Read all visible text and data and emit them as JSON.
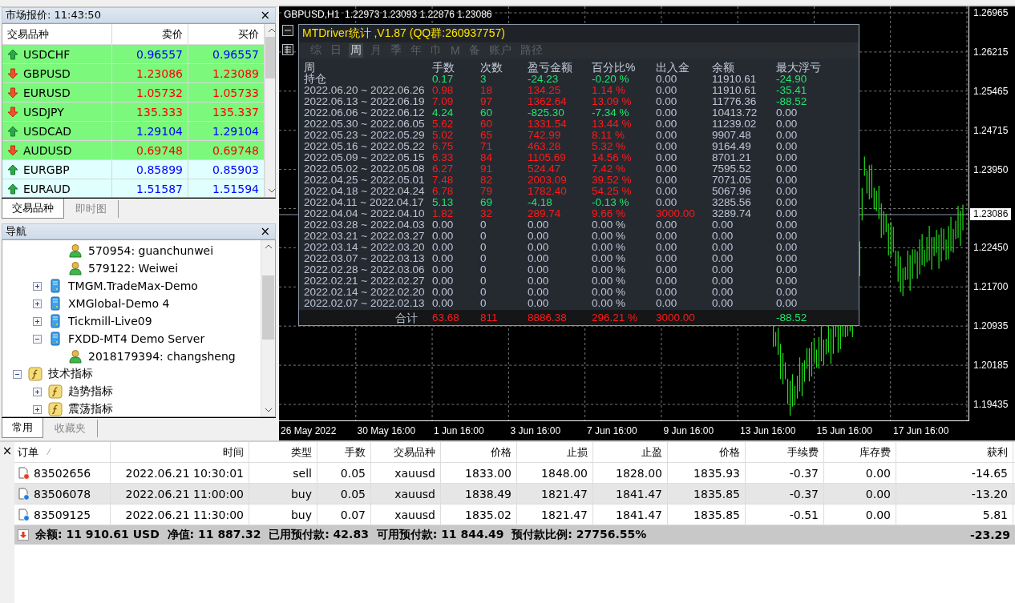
{
  "market_watch": {
    "title": "市场报价: 11:43:50",
    "close": "×",
    "columns": [
      "交易品种",
      "卖价",
      "买价"
    ],
    "rows": [
      {
        "symbol": "USDCHF",
        "bid": "0.96557",
        "ask": "0.96557",
        "kind": "up",
        "highlighted": true
      },
      {
        "symbol": "GBPUSD",
        "bid": "1.23086",
        "ask": "1.23089",
        "kind": "down",
        "highlighted": true
      },
      {
        "symbol": "EURUSD",
        "bid": "1.05732",
        "ask": "1.05733",
        "kind": "down",
        "highlighted": true
      },
      {
        "symbol": "USDJPY",
        "bid": "135.333",
        "ask": "135.337",
        "kind": "down",
        "highlighted": true
      },
      {
        "symbol": "USDCAD",
        "bid": "1.29104",
        "ask": "1.29104",
        "kind": "up",
        "highlighted": true
      },
      {
        "symbol": "AUDUSD",
        "bid": "0.69748",
        "ask": "0.69748",
        "kind": "down",
        "highlighted": true
      },
      {
        "symbol": "EURGBP",
        "bid": "0.85899",
        "ask": "0.85903",
        "kind": "up",
        "highlighted": false
      },
      {
        "symbol": "EURAUD",
        "bid": "1.51587",
        "ask": "1.51594",
        "kind": "up",
        "highlighted": false
      }
    ],
    "tabs": [
      {
        "label": "交易品种",
        "selected": true
      },
      {
        "label": "即时图",
        "selected": false
      }
    ]
  },
  "navigator": {
    "title": "导航",
    "close": "×",
    "tree": [
      {
        "children": [
          {
            "children": [
              {
                "label": "570954: guanchunwei",
                "kind": "account"
              },
              {
                "label": "579122: Weiwei",
                "kind": "account"
              }
            ]
          },
          {
            "label": "TMGM.TradeMax-Demo",
            "kind": "server",
            "expanded": false
          },
          {
            "label": "XMGlobal-Demo 4",
            "kind": "server",
            "expanded": false
          },
          {
            "label": "Tickmill-Live09",
            "kind": "server",
            "expanded": false
          },
          {
            "label": "FXDD-MT4 Demo Server",
            "kind": "server",
            "expanded": true,
            "children": [
              {
                "label": "2018179394: changsheng",
                "kind": "account"
              }
            ]
          }
        ]
      },
      {
        "label": "技术指标",
        "kind": "indicator",
        "expanded": true,
        "children": [
          {
            "label": "趋势指标",
            "kind": "indicator",
            "expanded": false
          },
          {
            "label": "震荡指标",
            "kind": "indicator",
            "expanded": false
          }
        ]
      }
    ],
    "tabs": [
      {
        "label": "常用",
        "selected": true
      },
      {
        "label": "收藏夹",
        "selected": false
      }
    ]
  },
  "chart": {
    "title": "GBPUSD,H1  1.22973 1.23093 1.22876 1.23086",
    "current_price": "1.23086",
    "price_labels": [
      "1.26965",
      "1.26215",
      "1.25465",
      "1.24715",
      "1.23950",
      "1.22450",
      "1.21700",
      "1.20935",
      "1.20185",
      "1.19435"
    ],
    "time_labels": [
      "26 May 2022",
      "30 May 16:00",
      "1 Jun 16:00",
      "3 Jun 16:00",
      "7 Jun 16:00",
      "9 Jun 16:00",
      "13 Jun 16:00",
      "15 Jun 16:00",
      "17 Jun 16:00"
    ]
  },
  "stats": {
    "title": "MTDriver统计 ,V1.87 (QQ群:260937757)",
    "menu": [
      {
        "label": "综",
        "selected": false
      },
      {
        "label": "日",
        "selected": false
      },
      {
        "label": "周",
        "selected": true
      },
      {
        "label": "月",
        "selected": false
      },
      {
        "label": "季",
        "selected": false
      },
      {
        "label": "年",
        "selected": false
      },
      {
        "label": "巾",
        "selected": false
      },
      {
        "label": "M",
        "selected": false
      },
      {
        "label": "备",
        "selected": false
      },
      {
        "label": "账户",
        "selected": false
      },
      {
        "label": "路径",
        "selected": false
      }
    ],
    "columns": [
      "周",
      "手数",
      "次数",
      "盈亏金额",
      "百分比%",
      "出入金",
      "余额",
      "最大浮亏"
    ],
    "rows": [
      {
        "cells": [
          "持仓",
          "0.17",
          "3",
          "-24.23",
          "-0.20 %",
          "0.00",
          "11910.61",
          "-24.90"
        ],
        "kind": "loss",
        "deposit_flagged": false,
        "float_flagged": true
      },
      {
        "cells": [
          "2022.06.20 ~ 2022.06.26",
          "0.98",
          "18",
          "134.25",
          "1.14 %",
          "0.00",
          "11910.61",
          "-35.41"
        ],
        "kind": "profit",
        "deposit_flagged": false,
        "float_flagged": true
      },
      {
        "cells": [
          "2022.06.13 ~ 2022.06.19",
          "7.09",
          "97",
          "1362.64",
          "13.09 %",
          "0.00",
          "11776.36",
          "-88.52"
        ],
        "kind": "profit",
        "deposit_flagged": false,
        "float_flagged": true
      },
      {
        "cells": [
          "2022.06.06 ~ 2022.06.12",
          "4.24",
          "60",
          "-825.30",
          "-7.34 %",
          "0.00",
          "10413.72",
          "0.00"
        ],
        "kind": "loss",
        "deposit_flagged": false,
        "float_flagged": false
      },
      {
        "cells": [
          "2022.05.30 ~ 2022.06.05",
          "5.62",
          "60",
          "1331.54",
          "13.44 %",
          "0.00",
          "11239.02",
          "0.00"
        ],
        "kind": "profit",
        "deposit_flagged": false,
        "float_flagged": false
      },
      {
        "cells": [
          "2022.05.23 ~ 2022.05.29",
          "5.02",
          "65",
          "742.99",
          "8.11 %",
          "0.00",
          "9907.48",
          "0.00"
        ],
        "kind": "profit",
        "deposit_flagged": false,
        "float_flagged": false
      },
      {
        "cells": [
          "2022.05.16 ~ 2022.05.22",
          "6.75",
          "71",
          "463.28",
          "5.32 %",
          "0.00",
          "9164.49",
          "0.00"
        ],
        "kind": "profit",
        "deposit_flagged": false,
        "float_flagged": false
      },
      {
        "cells": [
          "2022.05.09 ~ 2022.05.15",
          "6.33",
          "84",
          "1105.69",
          "14.56 %",
          "0.00",
          "8701.21",
          "0.00"
        ],
        "kind": "profit",
        "deposit_flagged": false,
        "float_flagged": false
      },
      {
        "cells": [
          "2022.05.02 ~ 2022.05.08",
          "6.27",
          "91",
          "524.47",
          "7.42 %",
          "0.00",
          "7595.52",
          "0.00"
        ],
        "kind": "profit",
        "deposit_flagged": false,
        "float_flagged": false
      },
      {
        "cells": [
          "2022.04.25 ~ 2022.05.01",
          "7.48",
          "82",
          "2003.09",
          "39.52 %",
          "0.00",
          "7071.05",
          "0.00"
        ],
        "kind": "profit",
        "deposit_flagged": false,
        "float_flagged": false
      },
      {
        "cells": [
          "2022.04.18 ~ 2022.04.24",
          "6.78",
          "79",
          "1782.40",
          "54.25 %",
          "0.00",
          "5067.96",
          "0.00"
        ],
        "kind": "profit",
        "deposit_flagged": false,
        "float_flagged": false
      },
      {
        "cells": [
          "2022.04.11 ~ 2022.04.17",
          "5.13",
          "69",
          "-4.18",
          "-0.13 %",
          "0.00",
          "3285.56",
          "0.00"
        ],
        "kind": "loss",
        "deposit_flagged": false,
        "float_flagged": false
      },
      {
        "cells": [
          "2022.04.04 ~ 2022.04.10",
          "1.82",
          "32",
          "289.74",
          "9.66 %",
          "3000.00",
          "3289.74",
          "0.00"
        ],
        "kind": "profit",
        "deposit_flagged": true,
        "float_flagged": false
      },
      {
        "cells": [
          "2022.03.28 ~ 2022.04.03",
          "0.00",
          "0",
          "0.00",
          "0.00 %",
          "0.00",
          "0.00",
          "0.00"
        ],
        "kind": "flat",
        "deposit_flagged": false,
        "float_flagged": false
      },
      {
        "cells": [
          "2022.03.21 ~ 2022.03.27",
          "0.00",
          "0",
          "0.00",
          "0.00 %",
          "0.00",
          "0.00",
          "0.00"
        ],
        "kind": "flat",
        "deposit_flagged": false,
        "float_flagged": false
      },
      {
        "cells": [
          "2022.03.14 ~ 2022.03.20",
          "0.00",
          "0",
          "0.00",
          "0.00 %",
          "0.00",
          "0.00",
          "0.00"
        ],
        "kind": "flat",
        "deposit_flagged": false,
        "float_flagged": false
      },
      {
        "cells": [
          "2022.03.07 ~ 2022.03.13",
          "0.00",
          "0",
          "0.00",
          "0.00 %",
          "0.00",
          "0.00",
          "0.00"
        ],
        "kind": "flat",
        "deposit_flagged": false,
        "float_flagged": false
      },
      {
        "cells": [
          "2022.02.28 ~ 2022.03.06",
          "0.00",
          "0",
          "0.00",
          "0.00 %",
          "0.00",
          "0.00",
          "0.00"
        ],
        "kind": "flat",
        "deposit_flagged": false,
        "float_flagged": false
      },
      {
        "cells": [
          "2022.02.21 ~ 2022.02.27",
          "0.00",
          "0",
          "0.00",
          "0.00 %",
          "0.00",
          "0.00",
          "0.00"
        ],
        "kind": "flat",
        "deposit_flagged": false,
        "float_flagged": false
      },
      {
        "cells": [
          "2022.02.14 ~ 2022.02.20",
          "0.00",
          "0",
          "0.00",
          "0.00 %",
          "0.00",
          "0.00",
          "0.00"
        ],
        "kind": "flat",
        "deposit_flagged": false,
        "float_flagged": false
      },
      {
        "cells": [
          "2022.02.07 ~ 2022.02.13",
          "0.00",
          "0",
          "0.00",
          "0.00 %",
          "0.00",
          "0.00",
          "0.00"
        ],
        "kind": "flat",
        "deposit_flagged": false,
        "float_flagged": false
      }
    ],
    "total": {
      "label": "合计",
      "lots": "63.68",
      "count": "811",
      "pnl": "8886.38",
      "pct": "296.21 %",
      "deposit": "3000.00",
      "max_float": "-88.52",
      "kind": "profit",
      "float_flagged": true
    }
  },
  "terminal": {
    "close": "×",
    "columns": [
      "订单",
      "时间",
      "类型",
      "手数",
      "交易品种",
      "价格",
      "止损",
      "止盈",
      "价格",
      "手续费",
      "库存费",
      "获利"
    ],
    "sort_mark": "⁄",
    "rows": [
      {
        "kind": "sell",
        "selected": false,
        "cells": [
          "83502656",
          "2022.06.21 10:30:01",
          "sell",
          "0.05",
          "xauusd",
          "1833.00",
          "1848.00",
          "1828.00",
          "1835.93",
          "-0.37",
          "0.00",
          "-14.65"
        ]
      },
      {
        "kind": "buy",
        "selected": true,
        "cells": [
          "83506078",
          "2022.06.21 11:00:00",
          "buy",
          "0.05",
          "xauusd",
          "1838.49",
          "1821.47",
          "1841.47",
          "1835.85",
          "-0.37",
          "0.00",
          "-13.20"
        ]
      },
      {
        "kind": "buy",
        "selected": false,
        "cells": [
          "83509125",
          "2022.06.21 11:30:00",
          "buy",
          "0.07",
          "xauusd",
          "1835.02",
          "1821.47",
          "1841.47",
          "1835.85",
          "-0.51",
          "0.00",
          "5.81"
        ]
      }
    ],
    "summary": {
      "text": "余额: 11 910.61 USD  净值: 11 887.32  已用预付款: 42.83  可用预付款: 11 844.49  预付款比例: 27756.55%",
      "profit": "-23.29"
    }
  }
}
